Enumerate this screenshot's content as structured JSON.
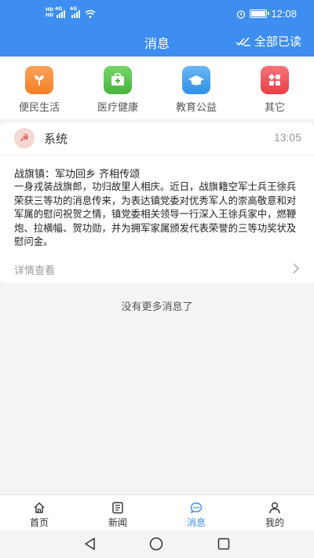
{
  "status_bar": {
    "time": "12:08",
    "sim_tag": "HD",
    "network": "4G",
    "battery_level": 1.0
  },
  "header": {
    "title": "消息",
    "read_all_label": "全部已读"
  },
  "categories": [
    {
      "label": "便民生活",
      "icon": "sprout-icon",
      "color": "#f7963a"
    },
    {
      "label": "医疗健康",
      "icon": "medical-kit-icon",
      "color": "#5fc653"
    },
    {
      "label": "教育公益",
      "icon": "graduation-cap-icon",
      "color": "#4aa3ee"
    },
    {
      "label": "其它",
      "icon": "grid-icon",
      "color": "#f0545a"
    }
  ],
  "message": {
    "sender": "系统",
    "time": "13:05",
    "title": "战旗镇：军功回乡 齐相传颂",
    "body": "一身戎装战旗郎，功归故里人相庆。近日，战旗籍空军士兵王徐兵荣获三等功的消息传来，为表达镇党委对优秀军人的崇高敬意和对军属的慰问祝贺之情，镇党委相关领导一行深入王徐兵家中，燃鞭炮、拉横幅、贺功勋，并为拥军家属颁发代表荣誉的三等功奖状及慰问金。",
    "detail_label": "详情查看"
  },
  "no_more": "没有更多消息了",
  "tabs": [
    {
      "label": "首页",
      "icon": "home-icon"
    },
    {
      "label": "新闻",
      "icon": "newspaper-icon"
    },
    {
      "label": "消息",
      "icon": "chat-icon",
      "active": true
    },
    {
      "label": "我的",
      "icon": "user-icon"
    }
  ],
  "colors": {
    "primary": "#3d8ef0",
    "background": "#f4f4f4"
  }
}
